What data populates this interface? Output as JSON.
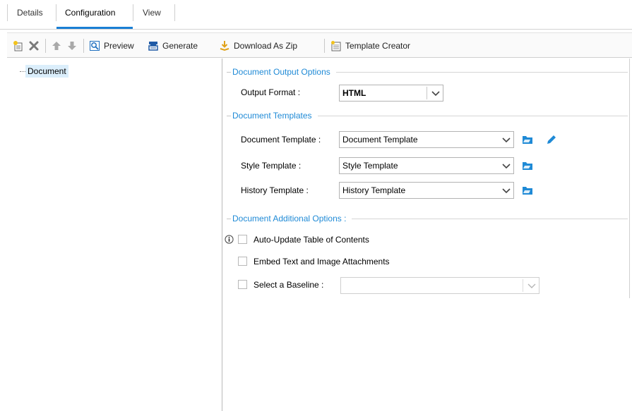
{
  "tabs": [
    {
      "label": "Details"
    },
    {
      "label": "Configuration"
    },
    {
      "label": "View"
    }
  ],
  "toolbar": {
    "preview_label": "Preview",
    "generate_label": "Generate",
    "download_label": "Download As Zip",
    "template_creator_label": "Template Creator"
  },
  "tree": {
    "root_label": "Document"
  },
  "output_options": {
    "title": "Document Output Options",
    "format_label": "Output Format :",
    "format_value": "HTML"
  },
  "templates": {
    "title": "Document Templates",
    "document_label": "Document Template :",
    "document_value": "Document Template",
    "style_label": "Style Template :",
    "style_value": "Style Template",
    "history_label": "History Template :",
    "history_value": "History Template"
  },
  "additional": {
    "title": "Document Additional Options :",
    "auto_update_label": "Auto-Update Table of Contents",
    "embed_label": "Embed Text and Image Attachments",
    "baseline_label": "Select a Baseline :",
    "baseline_value": ""
  },
  "colors": {
    "accent": "#1a7fd4",
    "group_title": "#1f8ad6",
    "selection": "#dbeefb"
  }
}
